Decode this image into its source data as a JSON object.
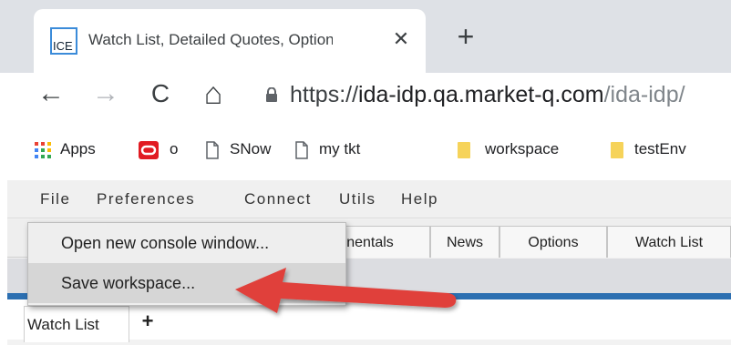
{
  "browser": {
    "tab": {
      "favicon_text": "ICE",
      "title": "Watch List, Detailed Quotes, Option:",
      "close": "✕"
    },
    "new_tab": "+",
    "nav": {
      "back": "←",
      "forward": "→",
      "reload": "C",
      "home": "⌂"
    },
    "url": {
      "scheme": "https://",
      "host": "ida-idp.qa.market-q.com",
      "path": "/ida-idp/"
    },
    "bookmarks": [
      {
        "label": "Apps",
        "icon": "apps-grid-icon"
      },
      {
        "label": "o",
        "icon": "oracle-icon"
      },
      {
        "label": "SNow",
        "icon": "page-icon"
      },
      {
        "label": "my tkt",
        "icon": "page-icon"
      },
      {
        "label": "workspace",
        "icon": "folder-icon"
      },
      {
        "label": "testEnv",
        "icon": "folder-icon"
      }
    ]
  },
  "app": {
    "menu": [
      "File",
      "Preferences",
      "Connect",
      "Utils",
      "Help"
    ],
    "top_tabs": [
      "nentals",
      "News",
      "Options",
      "Watch List"
    ],
    "worktabs": {
      "active": "Watch List",
      "add": "+"
    },
    "dropdown": {
      "items": [
        {
          "label": "Open new console window..."
        },
        {
          "label": "Save workspace...",
          "highlighted": true
        }
      ]
    }
  },
  "colors": {
    "arrow": "#e0403a",
    "accent_blue": "#2c6fb1",
    "favicon_border": "#3b8bd9",
    "apps_colors": [
      "#ea4335",
      "#fbbc05",
      "#34a853",
      "#4285f4"
    ],
    "oracle_red": "#e11b22",
    "folder_yellow": "#f6d35a"
  }
}
